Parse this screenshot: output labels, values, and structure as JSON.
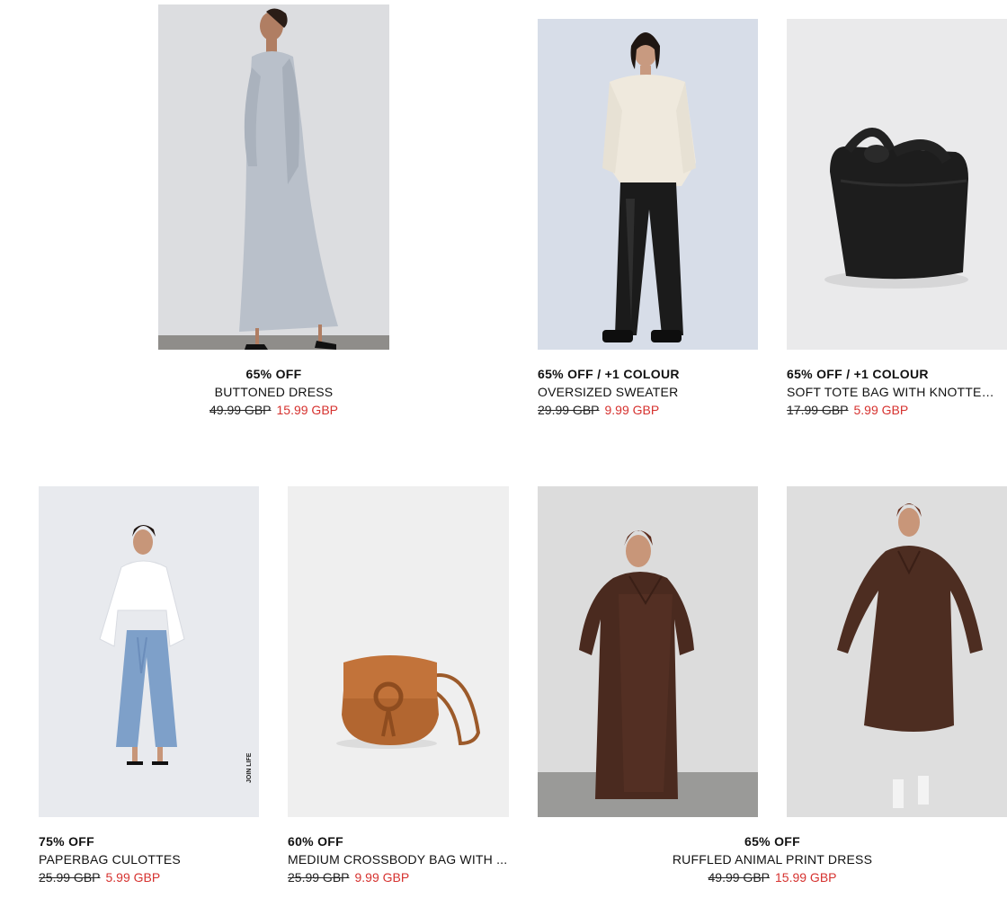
{
  "products": [
    {
      "discount": "65% OFF",
      "name": "BUTTONED DRESS",
      "old_price": "49.99 GBP",
      "new_price": "15.99 GBP",
      "image": "model in grey linen buttoned midi dress"
    },
    {
      "discount": "65% OFF / +1 COLOUR",
      "name": "OVERSIZED SWEATER",
      "old_price": "29.99 GBP",
      "new_price": "9.99 GBP",
      "image": "model in cream sweater and black leather trousers"
    },
    {
      "discount": "65% OFF / +1 COLOUR",
      "name": "SOFT TOTE BAG WITH KNOTTED ...",
      "old_price": "17.99 GBP",
      "new_price": "5.99 GBP",
      "image": "black soft tote bag with knotted strap"
    },
    {
      "discount": "75% OFF",
      "name": "PAPERBAG CULOTTES",
      "old_price": "25.99 GBP",
      "new_price": "5.99 GBP",
      "image": "model in white shirt and light blue culottes",
      "image_text": "JOIN LIFE"
    },
    {
      "discount": "60% OFF",
      "name": "MEDIUM CROSSBODY BAG WITH ...",
      "old_price": "25.99 GBP",
      "new_price": "9.99 GBP",
      "image": "tan leather crossbody bag"
    },
    {
      "discount": "65% OFF",
      "name": "RUFFLED ANIMAL PRINT DRESS",
      "old_price": "49.99 GBP",
      "new_price": "15.99 GBP",
      "image": "model in brown animal print dress, two views"
    }
  ],
  "colors": {
    "sale": "#d6322f",
    "text": "#111111"
  }
}
